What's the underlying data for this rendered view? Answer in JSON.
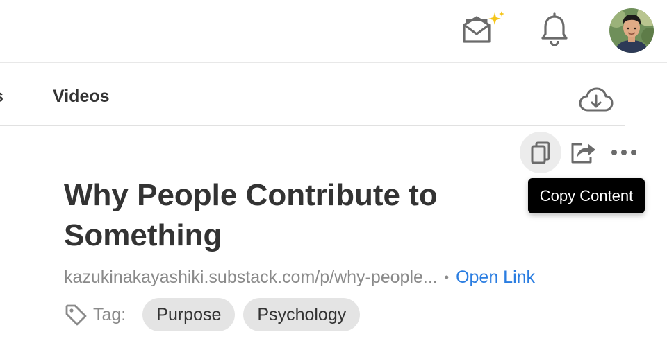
{
  "header": {
    "icons": {
      "inbox": "sparkle-mail-icon",
      "notifications": "bell-icon",
      "avatar": "user-avatar"
    }
  },
  "tabs": {
    "partial_label": "s",
    "videos_label": "Videos",
    "download_icon": "cloud-download-icon"
  },
  "actions": {
    "copy_icon": "copy-icon",
    "share_icon": "share-icon",
    "more_icon": "more-horizontal-icon",
    "tooltip": "Copy Content"
  },
  "article": {
    "title": "Why People Contribute to Something",
    "url": "kazukinakayashiki.substack.com/p/why-people...",
    "separator": "•",
    "open_link": "Open Link",
    "tag_label": "Tag:",
    "tags": [
      "Purpose",
      "Psychology"
    ]
  },
  "colors": {
    "link": "#2a7de1",
    "tooltip_bg": "#000000",
    "chip_bg": "#e4e4e4",
    "sparkle": "#f5c518"
  }
}
